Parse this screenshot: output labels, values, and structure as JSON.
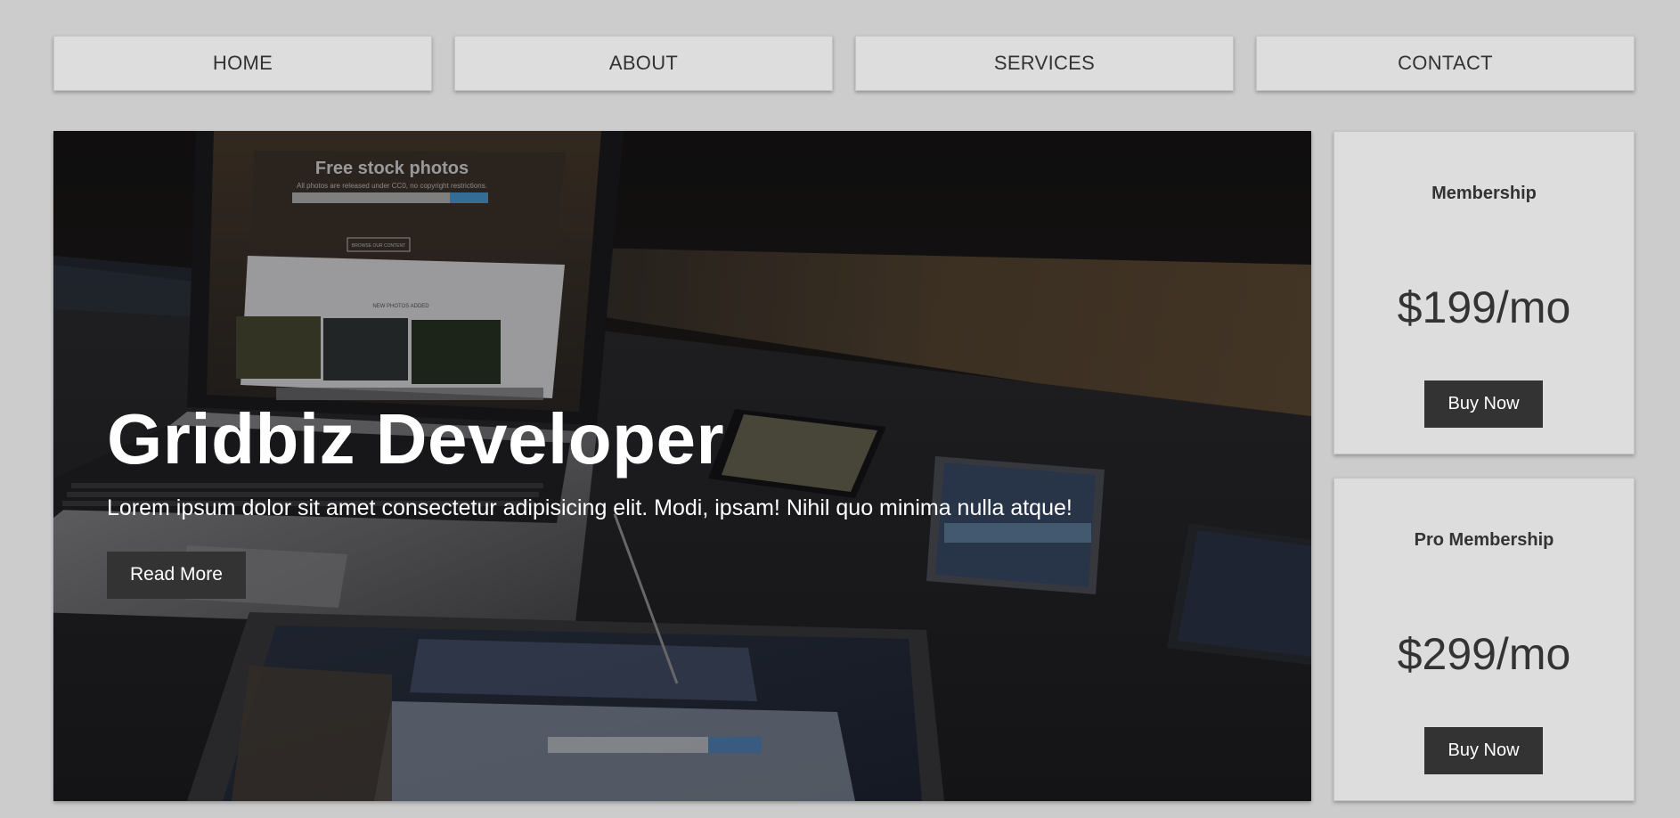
{
  "nav": {
    "items": [
      {
        "label": "HOME"
      },
      {
        "label": "ABOUT"
      },
      {
        "label": "SERVICES"
      },
      {
        "label": "CONTACT"
      }
    ]
  },
  "hero": {
    "title": "Gridbiz Developer",
    "text": "Lorem ipsum dolor sit amet consectetur adipisicing elit. Modi, ipsam! Nihil quo minima nulla atque!",
    "button_label": "Read More",
    "photo_screen_title": "Free stock photos",
    "photo_screen_subtitle": "All photos are released under CC0, no copyright restrictions.",
    "photo_screen_button": "BROWSE OUR CONTENT",
    "photo_screen_section": "NEW PHOTOS ADDED"
  },
  "pricing": [
    {
      "title": "Membership",
      "price": "$199/mo",
      "button_label": "Buy Now"
    },
    {
      "title": "Pro Membership",
      "price": "$299/mo",
      "button_label": "Buy Now"
    }
  ]
}
